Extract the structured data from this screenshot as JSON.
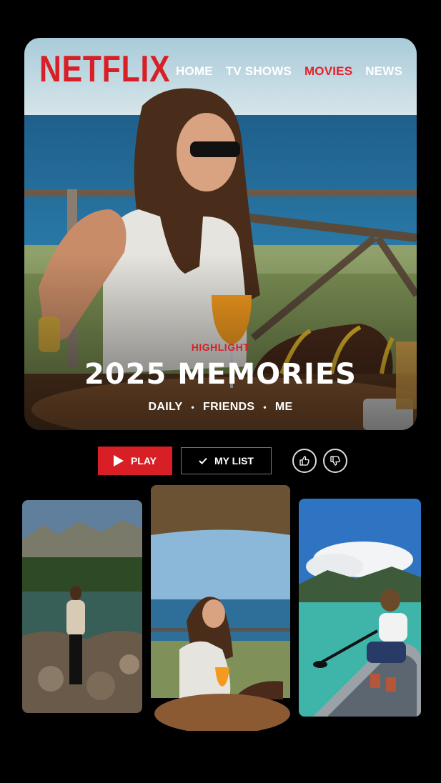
{
  "header": {
    "logo_text": "NETFLIX",
    "nav": [
      {
        "label": "HOME"
      },
      {
        "label": "TV SHOWS"
      },
      {
        "label": "MOVIES",
        "active": true
      },
      {
        "label": "NEWS"
      }
    ]
  },
  "hero": {
    "kicker": "HIGHLIGHT",
    "title": "2025 MEMORIES",
    "tags": [
      "DAILY",
      "FRIENDS",
      "ME"
    ],
    "separator": "•"
  },
  "actions": {
    "play_label": "PLAY",
    "mylist_label": "MY LIST",
    "icons": [
      "play-icon",
      "check-icon",
      "thumbs-up-icon",
      "thumbs-down-icon"
    ]
  },
  "thumbnails": [
    {
      "name": "mountain-lake-thumbnail"
    },
    {
      "name": "seaside-terrace-thumbnail"
    },
    {
      "name": "kayak-lake-thumbnail"
    }
  ],
  "colors": {
    "brand_red": "#d81f26",
    "active_nav": "#e3202b",
    "background": "#000000"
  }
}
